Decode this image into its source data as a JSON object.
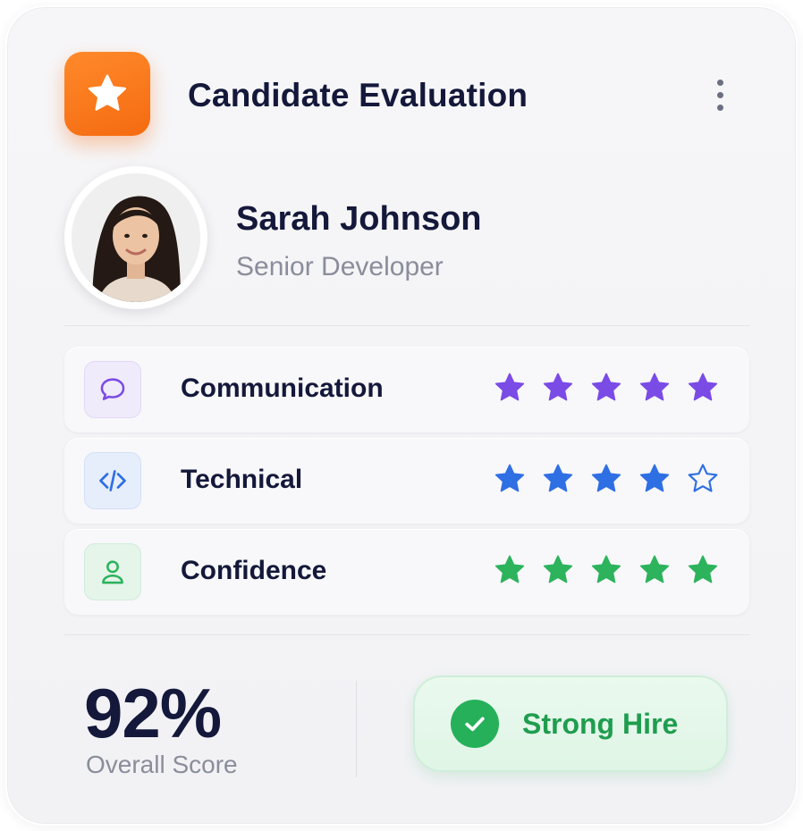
{
  "header": {
    "title": "Candidate Evaluation",
    "badge_icon": "star-icon",
    "badge_color": "#F57418",
    "menu_icon": "more-vertical-icon"
  },
  "candidate": {
    "name": "Sarah Johnson",
    "role": "Senior Developer",
    "avatar": "candidate-photo"
  },
  "criteria": [
    {
      "label": "Communication",
      "icon": "message-bubble-icon",
      "rating": 5,
      "max": 5,
      "color": "#7B4BE6",
      "icon_bg": "#F0EBFB"
    },
    {
      "label": "Technical",
      "icon": "code-brackets-icon",
      "rating": 4,
      "max": 5,
      "color": "#2F6FE4",
      "icon_bg": "#E6EEFB"
    },
    {
      "label": "Confidence",
      "icon": "user-icon",
      "rating": 5,
      "max": 5,
      "color": "#2DB35C",
      "icon_bg": "#E5F5EA"
    }
  ],
  "summary": {
    "score": "92%",
    "score_label": "Overall Score",
    "verdict": "Strong Hire",
    "verdict_icon": "check-circle-icon",
    "verdict_color": "#26B05A"
  }
}
